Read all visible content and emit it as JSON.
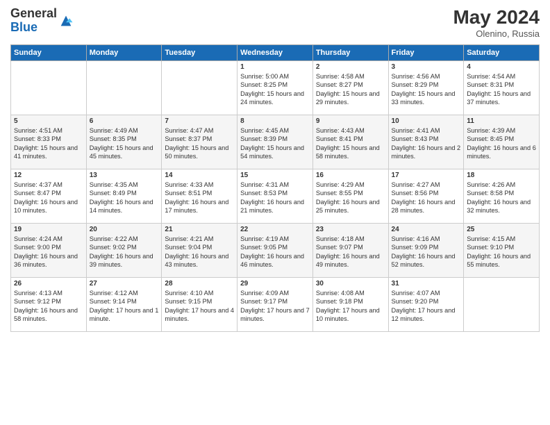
{
  "header": {
    "logo_general": "General",
    "logo_blue": "Blue",
    "month_year": "May 2024",
    "location": "Olenino, Russia"
  },
  "weekdays": [
    "Sunday",
    "Monday",
    "Tuesday",
    "Wednesday",
    "Thursday",
    "Friday",
    "Saturday"
  ],
  "weeks": [
    [
      {
        "day": "",
        "sunrise": "",
        "sunset": "",
        "daylight": ""
      },
      {
        "day": "",
        "sunrise": "",
        "sunset": "",
        "daylight": ""
      },
      {
        "day": "",
        "sunrise": "",
        "sunset": "",
        "daylight": ""
      },
      {
        "day": "1",
        "sunrise": "Sunrise: 5:00 AM",
        "sunset": "Sunset: 8:25 PM",
        "daylight": "Daylight: 15 hours and 24 minutes."
      },
      {
        "day": "2",
        "sunrise": "Sunrise: 4:58 AM",
        "sunset": "Sunset: 8:27 PM",
        "daylight": "Daylight: 15 hours and 29 minutes."
      },
      {
        "day": "3",
        "sunrise": "Sunrise: 4:56 AM",
        "sunset": "Sunset: 8:29 PM",
        "daylight": "Daylight: 15 hours and 33 minutes."
      },
      {
        "day": "4",
        "sunrise": "Sunrise: 4:54 AM",
        "sunset": "Sunset: 8:31 PM",
        "daylight": "Daylight: 15 hours and 37 minutes."
      }
    ],
    [
      {
        "day": "5",
        "sunrise": "Sunrise: 4:51 AM",
        "sunset": "Sunset: 8:33 PM",
        "daylight": "Daylight: 15 hours and 41 minutes."
      },
      {
        "day": "6",
        "sunrise": "Sunrise: 4:49 AM",
        "sunset": "Sunset: 8:35 PM",
        "daylight": "Daylight: 15 hours and 45 minutes."
      },
      {
        "day": "7",
        "sunrise": "Sunrise: 4:47 AM",
        "sunset": "Sunset: 8:37 PM",
        "daylight": "Daylight: 15 hours and 50 minutes."
      },
      {
        "day": "8",
        "sunrise": "Sunrise: 4:45 AM",
        "sunset": "Sunset: 8:39 PM",
        "daylight": "Daylight: 15 hours and 54 minutes."
      },
      {
        "day": "9",
        "sunrise": "Sunrise: 4:43 AM",
        "sunset": "Sunset: 8:41 PM",
        "daylight": "Daylight: 15 hours and 58 minutes."
      },
      {
        "day": "10",
        "sunrise": "Sunrise: 4:41 AM",
        "sunset": "Sunset: 8:43 PM",
        "daylight": "Daylight: 16 hours and 2 minutes."
      },
      {
        "day": "11",
        "sunrise": "Sunrise: 4:39 AM",
        "sunset": "Sunset: 8:45 PM",
        "daylight": "Daylight: 16 hours and 6 minutes."
      }
    ],
    [
      {
        "day": "12",
        "sunrise": "Sunrise: 4:37 AM",
        "sunset": "Sunset: 8:47 PM",
        "daylight": "Daylight: 16 hours and 10 minutes."
      },
      {
        "day": "13",
        "sunrise": "Sunrise: 4:35 AM",
        "sunset": "Sunset: 8:49 PM",
        "daylight": "Daylight: 16 hours and 14 minutes."
      },
      {
        "day": "14",
        "sunrise": "Sunrise: 4:33 AM",
        "sunset": "Sunset: 8:51 PM",
        "daylight": "Daylight: 16 hours and 17 minutes."
      },
      {
        "day": "15",
        "sunrise": "Sunrise: 4:31 AM",
        "sunset": "Sunset: 8:53 PM",
        "daylight": "Daylight: 16 hours and 21 minutes."
      },
      {
        "day": "16",
        "sunrise": "Sunrise: 4:29 AM",
        "sunset": "Sunset: 8:55 PM",
        "daylight": "Daylight: 16 hours and 25 minutes."
      },
      {
        "day": "17",
        "sunrise": "Sunrise: 4:27 AM",
        "sunset": "Sunset: 8:56 PM",
        "daylight": "Daylight: 16 hours and 28 minutes."
      },
      {
        "day": "18",
        "sunrise": "Sunrise: 4:26 AM",
        "sunset": "Sunset: 8:58 PM",
        "daylight": "Daylight: 16 hours and 32 minutes."
      }
    ],
    [
      {
        "day": "19",
        "sunrise": "Sunrise: 4:24 AM",
        "sunset": "Sunset: 9:00 PM",
        "daylight": "Daylight: 16 hours and 36 minutes."
      },
      {
        "day": "20",
        "sunrise": "Sunrise: 4:22 AM",
        "sunset": "Sunset: 9:02 PM",
        "daylight": "Daylight: 16 hours and 39 minutes."
      },
      {
        "day": "21",
        "sunrise": "Sunrise: 4:21 AM",
        "sunset": "Sunset: 9:04 PM",
        "daylight": "Daylight: 16 hours and 43 minutes."
      },
      {
        "day": "22",
        "sunrise": "Sunrise: 4:19 AM",
        "sunset": "Sunset: 9:05 PM",
        "daylight": "Daylight: 16 hours and 46 minutes."
      },
      {
        "day": "23",
        "sunrise": "Sunrise: 4:18 AM",
        "sunset": "Sunset: 9:07 PM",
        "daylight": "Daylight: 16 hours and 49 minutes."
      },
      {
        "day": "24",
        "sunrise": "Sunrise: 4:16 AM",
        "sunset": "Sunset: 9:09 PM",
        "daylight": "Daylight: 16 hours and 52 minutes."
      },
      {
        "day": "25",
        "sunrise": "Sunrise: 4:15 AM",
        "sunset": "Sunset: 9:10 PM",
        "daylight": "Daylight: 16 hours and 55 minutes."
      }
    ],
    [
      {
        "day": "26",
        "sunrise": "Sunrise: 4:13 AM",
        "sunset": "Sunset: 9:12 PM",
        "daylight": "Daylight: 16 hours and 58 minutes."
      },
      {
        "day": "27",
        "sunrise": "Sunrise: 4:12 AM",
        "sunset": "Sunset: 9:14 PM",
        "daylight": "Daylight: 17 hours and 1 minute."
      },
      {
        "day": "28",
        "sunrise": "Sunrise: 4:10 AM",
        "sunset": "Sunset: 9:15 PM",
        "daylight": "Daylight: 17 hours and 4 minutes."
      },
      {
        "day": "29",
        "sunrise": "Sunrise: 4:09 AM",
        "sunset": "Sunset: 9:17 PM",
        "daylight": "Daylight: 17 hours and 7 minutes."
      },
      {
        "day": "30",
        "sunrise": "Sunrise: 4:08 AM",
        "sunset": "Sunset: 9:18 PM",
        "daylight": "Daylight: 17 hours and 10 minutes."
      },
      {
        "day": "31",
        "sunrise": "Sunrise: 4:07 AM",
        "sunset": "Sunset: 9:20 PM",
        "daylight": "Daylight: 17 hours and 12 minutes."
      },
      {
        "day": "",
        "sunrise": "",
        "sunset": "",
        "daylight": ""
      }
    ]
  ]
}
